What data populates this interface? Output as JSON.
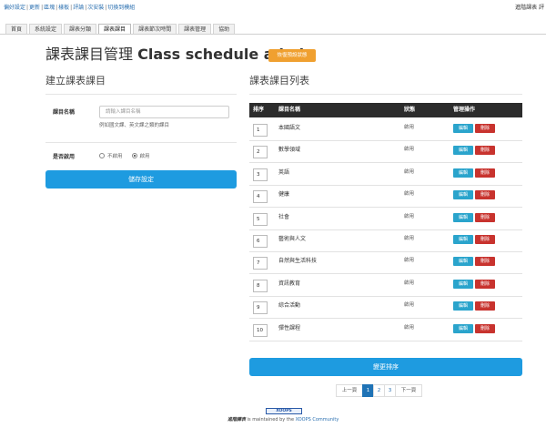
{
  "topbar": {
    "links": [
      "偏好設定",
      "更新",
      "區塊",
      "樣板",
      "評論",
      "次安裝",
      "切換到模組"
    ],
    "right_text": "進階課表 評"
  },
  "tabs": [
    "首頁",
    "系統設定",
    "課表分類",
    "課表課目",
    "課表節次時間",
    "課表管理",
    "協助"
  ],
  "active_tab": "課表課目",
  "page": {
    "title_zh": "課表課目管理",
    "title_en": "Class schedule admin",
    "restore_button": "恢復預設狀態"
  },
  "create_form": {
    "heading": "建立課表課目",
    "name_label": "課目名稱",
    "name_placeholder": "請輸入課目名稱",
    "name_help": "例如國文課、英文課之類的課目",
    "enable_label": "是否啟用",
    "options": [
      "不啟用",
      "啟用"
    ],
    "selected_option": "啟用",
    "save_button": "儲存設定"
  },
  "course_list": {
    "heading": "課表課目列表",
    "columns": [
      "排序",
      "課目名稱",
      "狀態",
      "管理操作"
    ],
    "edit_label": "編輯",
    "delete_label": "刪除",
    "rows": [
      {
        "order": "1",
        "name": "本國語文",
        "status": "啟用"
      },
      {
        "order": "2",
        "name": "數學領域",
        "status": "啟用"
      },
      {
        "order": "3",
        "name": "英語",
        "status": "啟用"
      },
      {
        "order": "4",
        "name": "健康",
        "status": "啟用"
      },
      {
        "order": "5",
        "name": "社會",
        "status": "啟用"
      },
      {
        "order": "6",
        "name": "藝術與人文",
        "status": "啟用"
      },
      {
        "order": "7",
        "name": "自然與生活科技",
        "status": "啟用"
      },
      {
        "order": "8",
        "name": "資訊教育",
        "status": "啟用"
      },
      {
        "order": "9",
        "name": "綜合活動",
        "status": "啟用"
      },
      {
        "order": "10",
        "name": "彈性課程",
        "status": "啟用"
      }
    ],
    "sort_button": "變更排序"
  },
  "pagination": {
    "prev": "上一頁",
    "pages": [
      "1",
      "2",
      "3"
    ],
    "current": "1",
    "next": "下一頁"
  },
  "footer": {
    "logo_text": "XOOPS",
    "module_name": "進階課表",
    "maintained_text": " is maintained by the ",
    "community": "XOOPS Community"
  }
}
